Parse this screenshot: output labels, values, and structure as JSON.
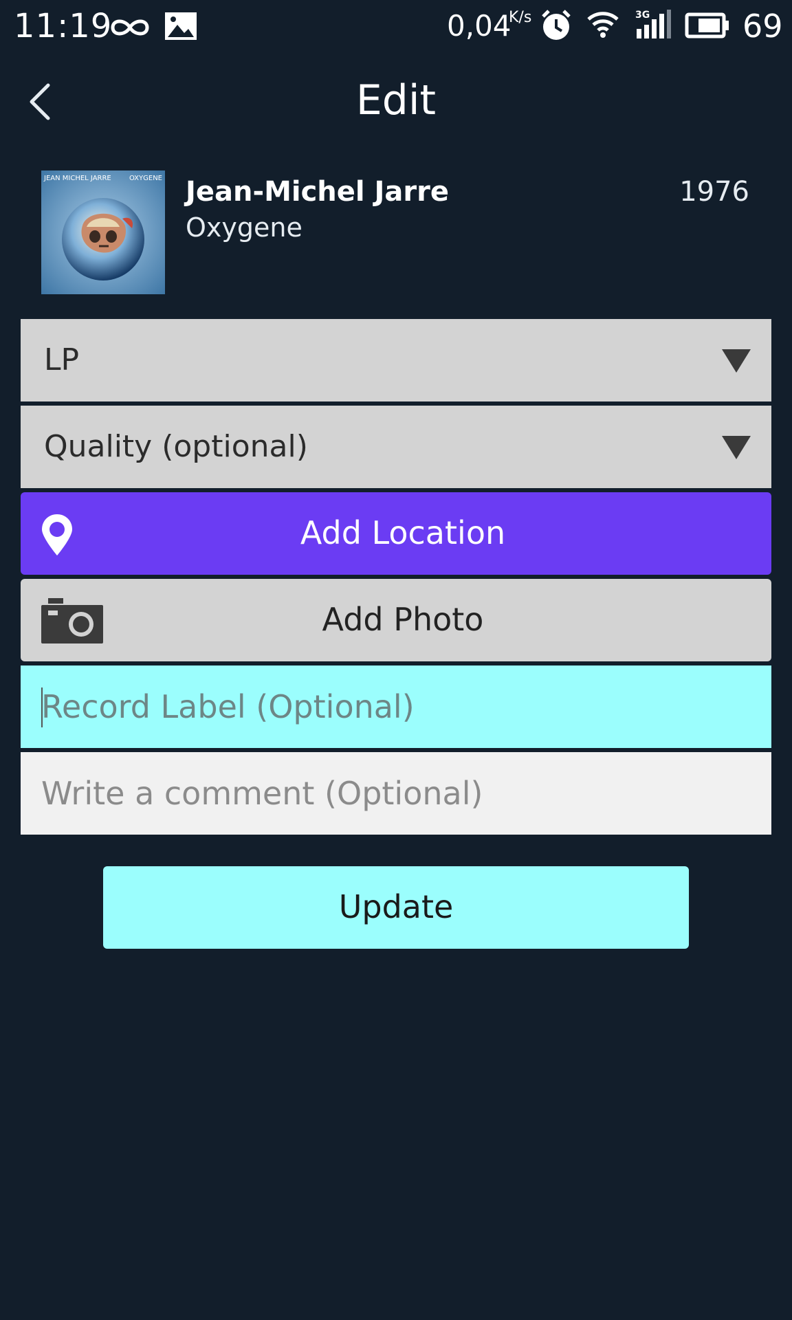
{
  "status_bar": {
    "time": "11:19",
    "speed_value": "0,04",
    "speed_unit": "K/s",
    "battery": "69",
    "icons": [
      "infinity-icon",
      "image-icon",
      "alarm-icon",
      "wifi-icon",
      "signal-3g-icon",
      "battery-icon"
    ]
  },
  "header": {
    "title": "Edit",
    "back_icon": "chevron-left-icon"
  },
  "album": {
    "artist": "Jean-Michel Jarre",
    "title": "Oxygene",
    "year": "1976",
    "cover_text_left": "JEAN MICHEL JARRE",
    "cover_text_right": "OXYGENE"
  },
  "form": {
    "format_value": "LP",
    "quality_placeholder": "Quality (optional)",
    "add_location_label": "Add Location",
    "add_photo_label": "Add Photo",
    "record_label_placeholder": "Record Label (Optional)",
    "comment_placeholder": "Write a comment (Optional)",
    "update_label": "Update"
  },
  "colors": {
    "background": "#121e2b",
    "location_button": "#6b3cf3",
    "accent_cyan": "#9bfefd",
    "select_grey": "#d3d3d3"
  }
}
